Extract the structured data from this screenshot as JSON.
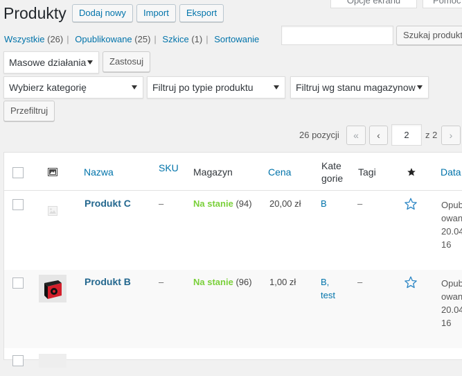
{
  "header": {
    "title": "Produkty",
    "add_new": "Dodaj nowy",
    "import": "Import",
    "export": "Eksport",
    "screen_options": "Opcje ekranu",
    "help": "Pomoc"
  },
  "views": [
    {
      "label": "Wszystkie",
      "count": "(26)"
    },
    {
      "label": "Opublikowane",
      "count": "(25)"
    },
    {
      "label": "Szkice",
      "count": "(1)"
    },
    {
      "label": "Sortowanie",
      "count": ""
    }
  ],
  "search": {
    "value": "",
    "button": "Szukaj produkt"
  },
  "bulk": {
    "selected": "Masowe działania",
    "apply": "Zastosuj"
  },
  "filters": {
    "category": "Wybierz kategorię",
    "product_type": "Filtruj po typie produktu",
    "stock": "Filtruj wg stanu magazynow",
    "submit": "Przefiltruj"
  },
  "pagination": {
    "items": "26 pozycji",
    "first": "«",
    "prev": "‹",
    "current": "2",
    "of": "z 2",
    "next": "›"
  },
  "columns": {
    "name": "Nazwa",
    "sku": "SKU",
    "stock": "Magazyn",
    "price": "Cena",
    "categories_line1": "Kate",
    "categories_line2": "gorie",
    "tags": "Tagi",
    "date": "Data"
  },
  "rows": [
    {
      "name": "Produkt C",
      "sku": "–",
      "stock_status": "Na stanie",
      "stock_qty": "(94)",
      "price": "20,00 zł",
      "cat1": "B",
      "cat2": "",
      "tags": "–",
      "date1": "Opub",
      "date2": "owan",
      "date3": "20.04",
      "date4": "16",
      "thumb": "placeholder-image-icon"
    },
    {
      "name": "Produkt B",
      "sku": "–",
      "stock_status": "Na stanie",
      "stock_qty": "(96)",
      "price": "1,00 zł",
      "cat1": "B,",
      "cat2": "test",
      "tags": "–",
      "date1": "Opub",
      "date2": "owan",
      "date3": "20.04",
      "date4": "16",
      "thumb": "product-box-image"
    }
  ],
  "colors": {
    "link": "#0073aa",
    "in_stock": "#7ad03a",
    "background": "#f1f1f1"
  }
}
